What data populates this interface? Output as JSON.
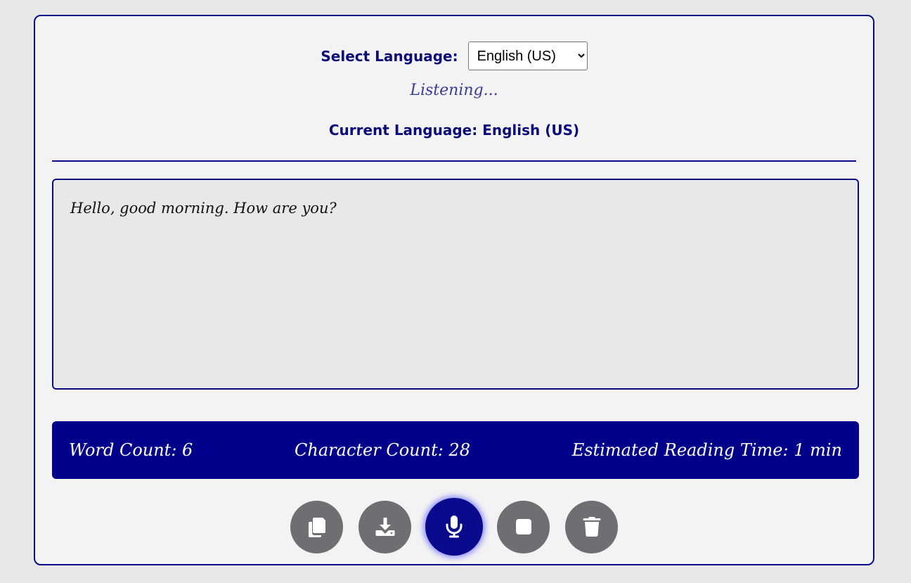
{
  "language": {
    "label": "Select Language:",
    "selected": "English (US)",
    "options": [
      "English (US)"
    ]
  },
  "status_text": "Listening...",
  "current_language_text": "Current Language: English (US)",
  "transcript": "Hello, good morning. How are you?",
  "stats": {
    "word_count": "Word Count: 6",
    "character_count": "Character Count: 28",
    "reading_time": "Estimated Reading Time: 1 min"
  },
  "buttons": [
    {
      "name": "copy",
      "icon": "copy-icon"
    },
    {
      "name": "download",
      "icon": "download-icon"
    },
    {
      "name": "microphone",
      "icon": "microphone-icon"
    },
    {
      "name": "stop",
      "icon": "stop-icon"
    },
    {
      "name": "clear",
      "icon": "trash-icon"
    }
  ],
  "colors": {
    "accent": "#00008b",
    "button_gray": "#6f6e73",
    "card_bg": "#f3f3f3"
  }
}
